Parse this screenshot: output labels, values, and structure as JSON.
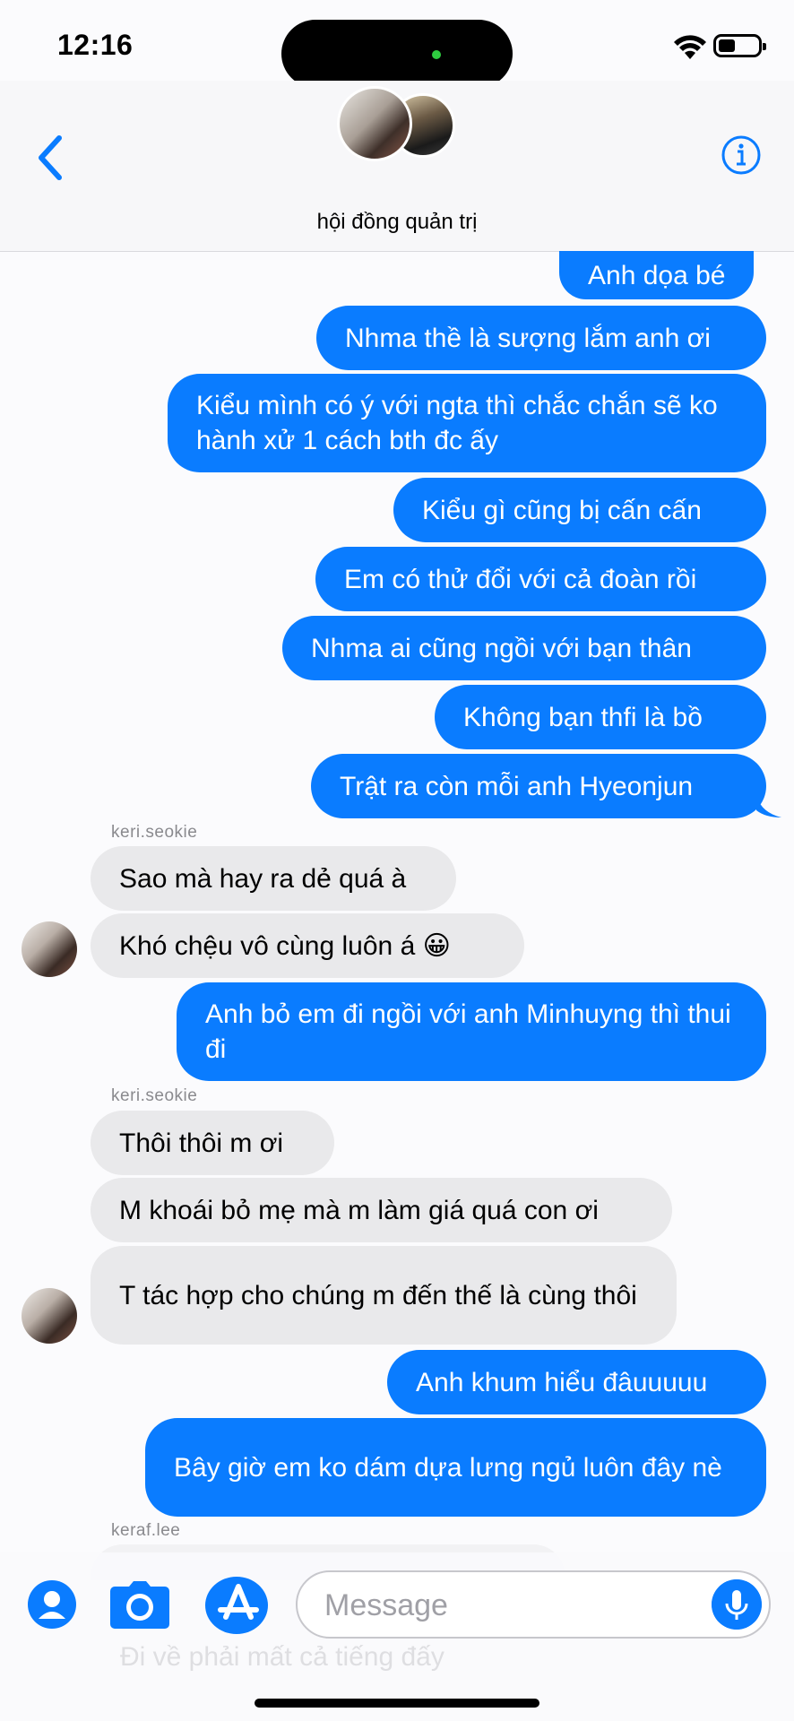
{
  "status": {
    "time": "12:16"
  },
  "header": {
    "group_name": "hội đồng quản trị"
  },
  "messages": {
    "m0": "Anh dọa bé",
    "m1": "Nhma thề là sượng lắm anh ơi",
    "m2": "Kiểu mình có ý với ngta thì chắc chắn sẽ ko hành xử 1 cách bth đc ấy",
    "m3": "Kiểu gì cũng bị cấn cấn",
    "m4": "Em có thử đổi với cả đoàn rồi",
    "m5": "Nhma ai cũng ngồi với bạn thân",
    "m6": "Không bạn thfi là bồ",
    "m7": "Trật ra còn mỗi anh Hyeonjun",
    "sender1": "keri.seokie",
    "m8": "Sao mà hay ra dẻ quá à",
    "m9": "Khó chệu vô cùng luôn á 😀",
    "m10": "Anh bỏ em đi ngồi với anh Minhuyng thì thui đi",
    "sender2": "keri.seokie",
    "m11": "Thôi thôi m ơi",
    "m12": "M khoái bỏ mẹ mà m làm giá quá con ơi",
    "m13": "T tác hợp cho chúng m đến thế là cùng thôi",
    "m14": "Anh khum hiểu đâuuuuu",
    "m15": "Bây giờ em ko dám dựa lưng ngủ luôn đây nè",
    "sender3": "keraf.lee",
    "ghost1": "Đi về phải mất cả tiếng đấy"
  },
  "input": {
    "placeholder": "Message"
  },
  "colors": {
    "outgoing": "#0a7cff",
    "incoming": "#e9e9eb",
    "accent": "#0a7cff"
  },
  "icons": [
    "back-chevron-icon",
    "info-icon",
    "contact-icon",
    "camera-icon",
    "app-store-icon",
    "mic-icon"
  ]
}
